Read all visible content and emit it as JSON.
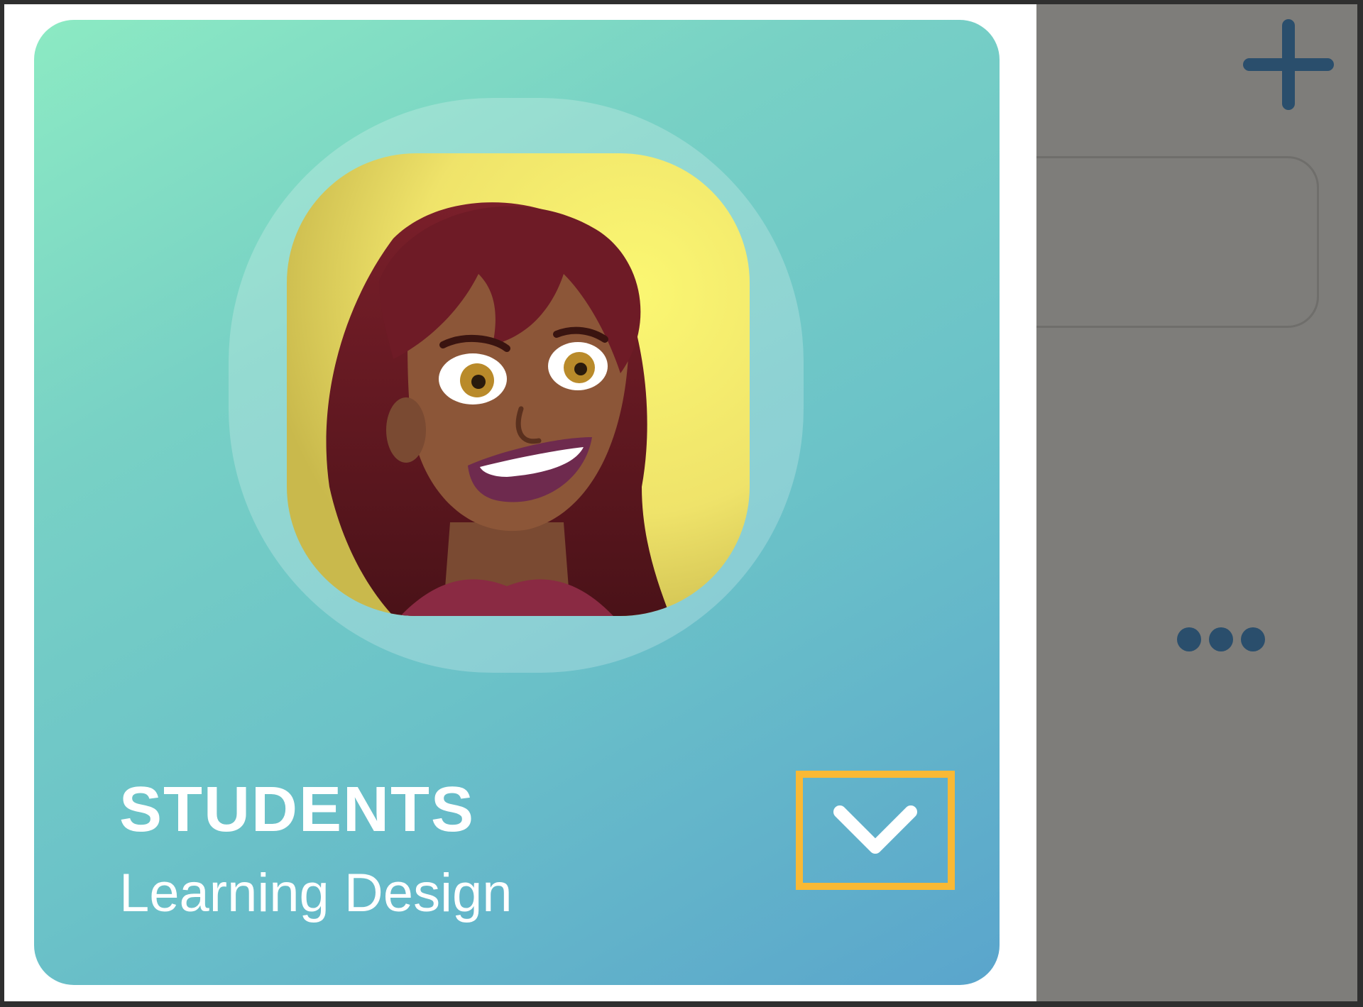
{
  "card": {
    "title": "STUDENTS",
    "subtitle": "Learning Design",
    "gradient_colors": [
      "#8ceac3",
      "#5aa5cc"
    ],
    "avatar_icon": "student-avatar-illustration"
  },
  "expand_button": {
    "icon": "chevron-down-icon",
    "highlight_color": "#f9b935"
  },
  "side_panel": {
    "background": "#7e7d7a",
    "icon_color": "#2a4e6c",
    "add_icon": "plus-icon",
    "more_icon": "more-horizontal-icon"
  }
}
